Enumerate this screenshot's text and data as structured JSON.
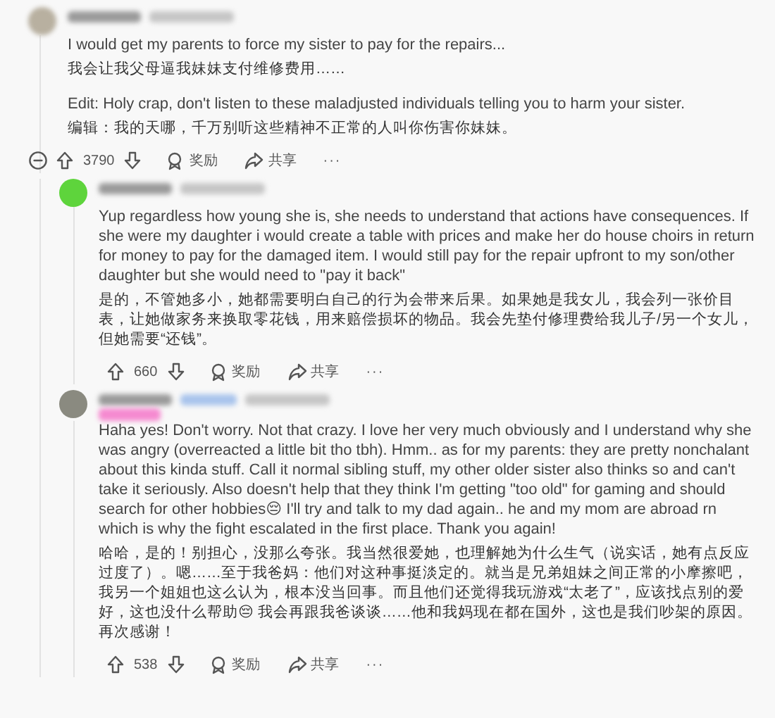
{
  "comments": [
    {
      "blocks": [
        {
          "en": "I would get my parents to force my sister to pay for the repairs...",
          "zh": "我会让我父母逼我妹妹支付维修费用……"
        },
        {
          "en": "Edit: Holy crap, don't listen to these maladjusted individuals telling you to harm your sister.",
          "zh": "编辑：我的天哪，千万别听这些精神不正常的人叫你伤害你妹妹。"
        }
      ],
      "collapse": true,
      "votes": "3790",
      "award": "奖励",
      "share": "共享",
      "more": "···",
      "children": [
        {
          "color": "#5ed43c",
          "blocks": [
            {
              "en": "Yup regardless how young she is, she needs to understand that actions have consequences. If she were my daughter i would create a table with prices and make her do house choirs in return for money to pay for the damaged item. I would still pay for the repair upfront to my son/other daughter but she would need to \"pay it back\"",
              "zh": "是的，不管她多小，她都需要明白自己的行为会带来后果。如果她是我女儿，我会列一张价目表，让她做家务来换取零花钱，用来赔偿损坏的物品。我会先垫付修理费给我儿子/另一个女儿，但她需要“还钱”。"
            }
          ],
          "votes": "660",
          "award": "奖励",
          "share": "共享",
          "more": "···"
        },
        {
          "color": "#8a8a80",
          "flair": true,
          "blocks": [
            {
              "en": "Haha yes! Don't worry. Not that crazy. I love her very much obviously and I understand why she was angry (overreacted a little bit tho tbh). Hmm.. as for my parents: they are pretty nonchalant about this kinda stuff. Call it normal sibling stuff, my other older sister also thinks so and can't take it seriously. Also doesn't help that they think I'm getting \"too old\" for gaming and should search for other hobbies😔 I'll try and talk to my dad again.. he and my mom are abroad rn which is why the fight escalated in the first place. Thank you again!",
              "zh": "哈哈，是的！别担心，没那么夸张。我当然很爱她，也理解她为什么生气（说实话，她有点反应过度了）。嗯……至于我爸妈：他们对这种事挺淡定的。就当是兄弟姐妹之间正常的小摩擦吧，我另一个姐姐也这么认为，根本没当回事。而且他们还觉得我玩游戏“太老了”，应该找点别的爱好，这也没什么帮助😔 我会再跟我爸谈谈……他和我妈现在都在国外，这也是我们吵架的原因。再次感谢！"
            }
          ],
          "votes": "538",
          "award": "奖励",
          "share": "共享",
          "more": "···"
        }
      ]
    }
  ]
}
